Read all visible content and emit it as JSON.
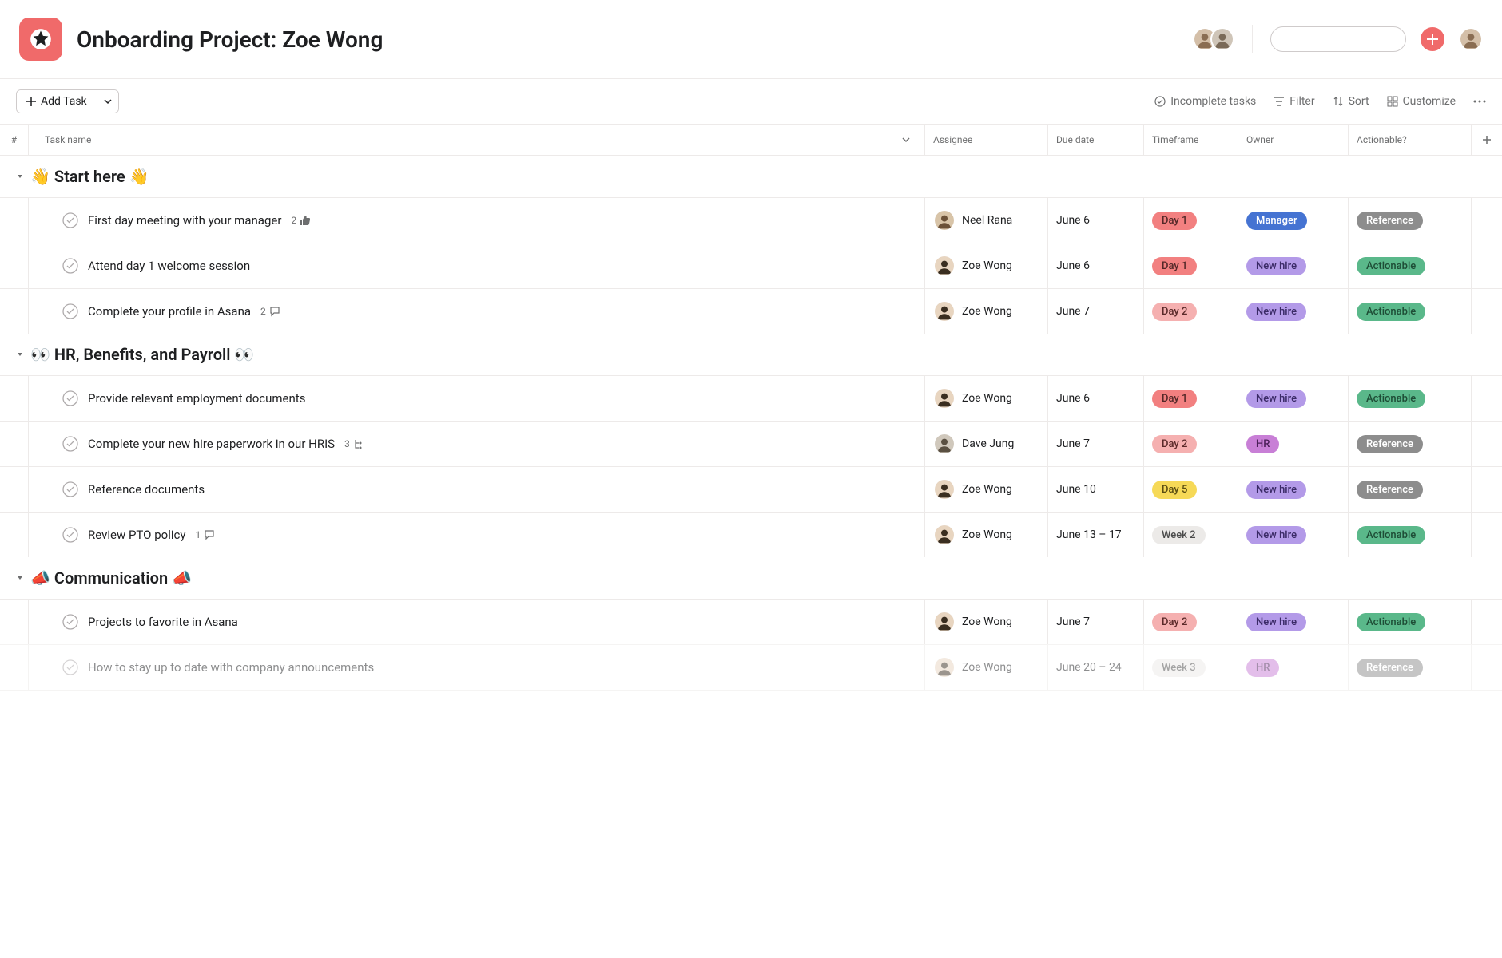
{
  "header": {
    "title": "Onboarding Project: Zoe Wong"
  },
  "toolbar": {
    "add_task": "Add Task",
    "incomplete": "Incomplete tasks",
    "filter": "Filter",
    "sort": "Sort",
    "customize": "Customize"
  },
  "columns": {
    "num": "#",
    "name": "Task name",
    "assignee": "Assignee",
    "due": "Due date",
    "timeframe": "Timeframe",
    "owner": "Owner",
    "actionable": "Actionable?"
  },
  "sections": [
    {
      "title": "👋 Start here 👋",
      "tasks": [
        {
          "name": "First day meeting with your manager",
          "meta_count": "2",
          "meta_icon": "like",
          "assignee": "Neel Rana",
          "avatar": "a1",
          "due": "June 6",
          "timeframe": "Day 1",
          "timeframe_class": "pill-day1",
          "owner": "Manager",
          "owner_class": "pill-manager",
          "actionable": "Reference",
          "actionable_class": "pill-reference"
        },
        {
          "name": "Attend day 1 welcome session",
          "assignee": "Zoe Wong",
          "avatar": "a2",
          "due": "June 6",
          "timeframe": "Day 1",
          "timeframe_class": "pill-day1",
          "owner": "New hire",
          "owner_class": "pill-newhire",
          "actionable": "Actionable",
          "actionable_class": "pill-actionable"
        },
        {
          "name": "Complete your profile in Asana",
          "meta_count": "2",
          "meta_icon": "comment",
          "assignee": "Zoe Wong",
          "avatar": "a2",
          "due": "June 7",
          "timeframe": "Day 2",
          "timeframe_class": "pill-day2",
          "owner": "New hire",
          "owner_class": "pill-newhire",
          "actionable": "Actionable",
          "actionable_class": "pill-actionable"
        }
      ]
    },
    {
      "title": "👀 HR, Benefits, and Payroll 👀",
      "tasks": [
        {
          "name": "Provide relevant employment documents",
          "assignee": "Zoe Wong",
          "avatar": "a2",
          "due": "June 6",
          "timeframe": "Day 1",
          "timeframe_class": "pill-day1",
          "owner": "New hire",
          "owner_class": "pill-newhire",
          "actionable": "Actionable",
          "actionable_class": "pill-actionable"
        },
        {
          "name": "Complete your new hire paperwork in our HRIS",
          "meta_count": "3",
          "meta_icon": "subtask",
          "assignee": "Dave Jung",
          "avatar": "a3",
          "due": "June 7",
          "timeframe": "Day 2",
          "timeframe_class": "pill-day2",
          "owner": "HR",
          "owner_class": "pill-hr",
          "actionable": "Reference",
          "actionable_class": "pill-reference"
        },
        {
          "name": "Reference documents",
          "assignee": "Zoe Wong",
          "avatar": "a2",
          "due": "June 10",
          "timeframe": "Day 5",
          "timeframe_class": "pill-day5",
          "owner": "New hire",
          "owner_class": "pill-newhire",
          "actionable": "Reference",
          "actionable_class": "pill-reference"
        },
        {
          "name": "Review PTO policy",
          "meta_count": "1",
          "meta_icon": "comment",
          "assignee": "Zoe Wong",
          "avatar": "a2",
          "due": "June 13 – 17",
          "timeframe": "Week 2",
          "timeframe_class": "pill-week2",
          "owner": "New hire",
          "owner_class": "pill-newhire",
          "actionable": "Actionable",
          "actionable_class": "pill-actionable"
        }
      ]
    },
    {
      "title": "📣 Communication 📣",
      "tasks": [
        {
          "name": "Projects to favorite in Asana",
          "assignee": "Zoe Wong",
          "avatar": "a2",
          "due": "June 7",
          "timeframe": "Day 2",
          "timeframe_class": "pill-day2",
          "owner": "New hire",
          "owner_class": "pill-newhire",
          "actionable": "Actionable",
          "actionable_class": "pill-actionable"
        },
        {
          "name": "How to stay up to date with company announcements",
          "faded": true,
          "assignee": "Zoe Wong",
          "avatar": "a2",
          "due": "June 20 – 24",
          "timeframe": "Week 3",
          "timeframe_class": "pill-week3",
          "owner": "HR",
          "owner_class": "pill-hr",
          "actionable": "Reference",
          "actionable_class": "pill-reference"
        }
      ]
    }
  ]
}
